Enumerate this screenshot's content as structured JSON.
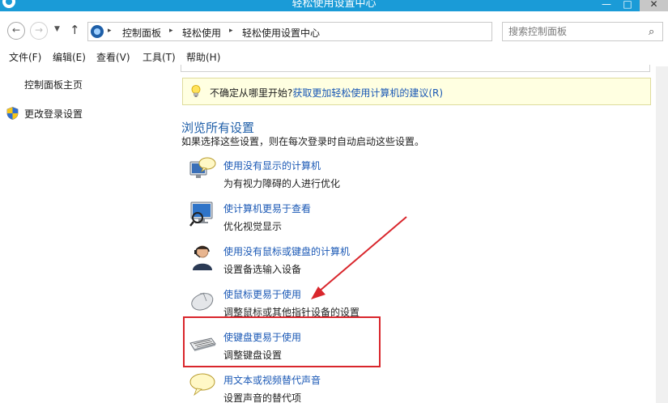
{
  "window": {
    "title": "轻松使用设置中心",
    "min_glyph": "—",
    "max_glyph": "□",
    "close_glyph": "✕"
  },
  "address_bar": {
    "back_glyph": "←",
    "forward_glyph": "→",
    "recent_glyph": "▼",
    "up_glyph": "↑",
    "breadcrumbs": [
      "控制面板",
      "轻松使用",
      "轻松使用设置中心"
    ],
    "separator_glyph": "▸",
    "dropdown_glyph": "⌄",
    "refresh_glyph": "↻",
    "search_placeholder": "搜索控制面板",
    "search_glyph": "⌕"
  },
  "menu": [
    {
      "label": "文件(F)"
    },
    {
      "label": "编辑(E)"
    },
    {
      "label": "查看(V)"
    },
    {
      "label": "工具(T)"
    },
    {
      "label": "帮助(H)"
    }
  ],
  "left_pane": {
    "home_link": "控制面板主页",
    "login_link": "更改登录设置",
    "login_icon": "shield-icon"
  },
  "tip": {
    "prefix": "不确定从哪里开始?",
    "link": "获取更加轻松使用计算机的建议(R)",
    "icon": "lightbulb-icon"
  },
  "section": {
    "title": "浏览所有设置",
    "description": "如果选择这些设置，则在每次登录时自动启动这些设置。"
  },
  "options": [
    {
      "link": "使用没有显示的计算机",
      "desc": "为有视力障碍的人进行优化",
      "icon": "speech-monitor-icon"
    },
    {
      "link": "使计算机更易于查看",
      "desc": "优化视觉显示",
      "icon": "monitor-magnifier-icon"
    },
    {
      "link": "使用没有鼠标或键盘的计算机",
      "desc": "设置备选输入设备",
      "icon": "person-headset-icon"
    },
    {
      "link": "使鼠标更易于使用",
      "desc": "调整鼠标或其他指针设备的设置",
      "icon": "mouse-icon"
    },
    {
      "link": "使键盘更易于使用",
      "desc": "调整键盘设置",
      "icon": "keyboard-icon"
    },
    {
      "link": "用文本或视频替代声音",
      "desc": "设置声音的替代项",
      "icon": "speech-bubble-icon"
    }
  ],
  "colors": {
    "title_bar": "#1a9bd7",
    "link": "#1a58b5",
    "section_title": "#1e5ea8",
    "tip_background": "#ffffe1",
    "annotation_red": "#d9262c"
  }
}
